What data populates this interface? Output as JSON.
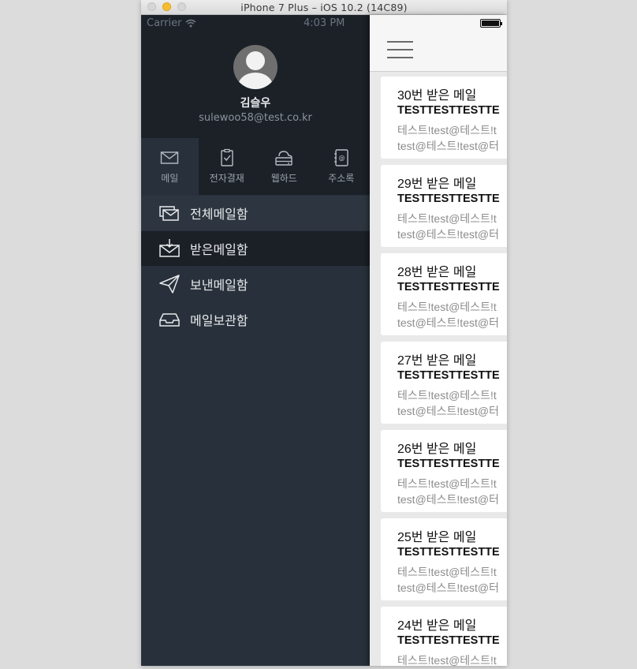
{
  "window": {
    "title": "iPhone 7 Plus – iOS 10.2 (14C89)"
  },
  "status_bar": {
    "carrier": "Carrier",
    "time": "4:03 PM"
  },
  "profile": {
    "name": "김슬우",
    "email": "sulewoo58@test.co.kr"
  },
  "app_tabs": [
    {
      "label": "메일",
      "icon": "envelope-icon",
      "active": true
    },
    {
      "label": "전자결재",
      "icon": "clipboard-check-icon",
      "active": false
    },
    {
      "label": "웹하드",
      "icon": "cloud-drive-icon",
      "active": false
    },
    {
      "label": "주소록",
      "icon": "address-book-icon",
      "active": false
    }
  ],
  "menu": [
    {
      "label": "전체메일함",
      "icon": "all-mail-icon"
    },
    {
      "label": "받은메일함",
      "icon": "inbox-icon",
      "selected": true
    },
    {
      "label": "보낸메일함",
      "icon": "paper-plane-icon"
    },
    {
      "label": "메일보관함",
      "icon": "archive-tray-icon"
    }
  ],
  "mails": [
    {
      "subject": "30번 받은 메일",
      "preview1": "TESTTESTTESTTE",
      "preview2": "테스트!test@테스트!t",
      "preview3": "test@테스트!test@터"
    },
    {
      "subject": "29번 받은 메일",
      "preview1": "TESTTESTTESTTE",
      "preview2": "테스트!test@테스트!t",
      "preview3": "test@테스트!test@터"
    },
    {
      "subject": "28번 받은 메일",
      "preview1": "TESTTESTTESTTE",
      "preview2": "테스트!test@테스트!t",
      "preview3": "test@테스트!test@터"
    },
    {
      "subject": "27번 받은 메일",
      "preview1": "TESTTESTTESTTE",
      "preview2": "테스트!test@테스트!t",
      "preview3": "test@테스트!test@터"
    },
    {
      "subject": "26번 받은 메일",
      "preview1": "TESTTESTTESTTE",
      "preview2": "테스트!test@테스트!t",
      "preview3": "test@테스트!test@터"
    },
    {
      "subject": "25번 받은 메일",
      "preview1": "TESTTESTTESTTE",
      "preview2": "테스트!test@테스트!t",
      "preview3": "test@테스트!test@터"
    },
    {
      "subject": "24번 받은 메일",
      "preview1": "TESTTESTTESTTE",
      "preview2": "테스트!test@테스트!t",
      "preview3": ""
    }
  ],
  "colors": {
    "drawer_bg": "#28313b",
    "drawer_header_bg": "#1c2128",
    "selected_item_bg": "#1b2027",
    "list_bg": "#e9e9ea",
    "card_bg": "#ffffff"
  }
}
